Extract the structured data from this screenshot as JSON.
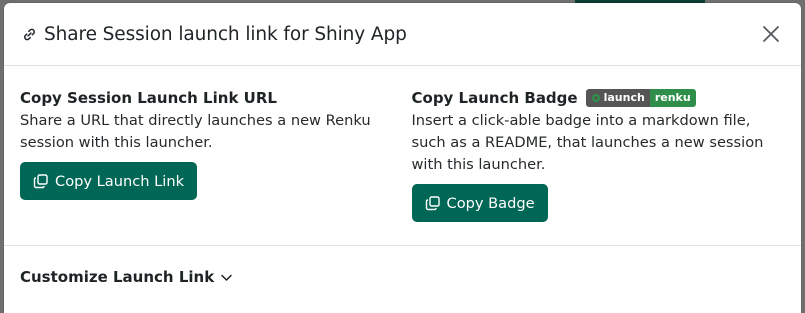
{
  "modal": {
    "title": "Share Session launch link for Shiny App",
    "title_icon": "link-icon",
    "close_icon": "close-icon"
  },
  "left": {
    "heading": "Copy Session Launch Link URL",
    "description": "Share a URL that directly launches a new Renku session with this launcher.",
    "button_label": "Copy Launch Link",
    "button_icon": "copy-icon"
  },
  "right": {
    "heading": "Copy Launch Badge",
    "badge_left": "launch",
    "badge_right": "renku",
    "description": "Insert a click-able badge into a markdown file, such as a README, that launches a new session with this launcher.",
    "button_label": "Copy Badge",
    "button_icon": "copy-icon"
  },
  "footer": {
    "customize_label": "Customize Launch Link",
    "customize_icon": "chevron-down-icon"
  },
  "colors": {
    "primary": "#006655",
    "badge_left_bg": "#555555",
    "badge_right_bg": "#2f8f4a"
  }
}
